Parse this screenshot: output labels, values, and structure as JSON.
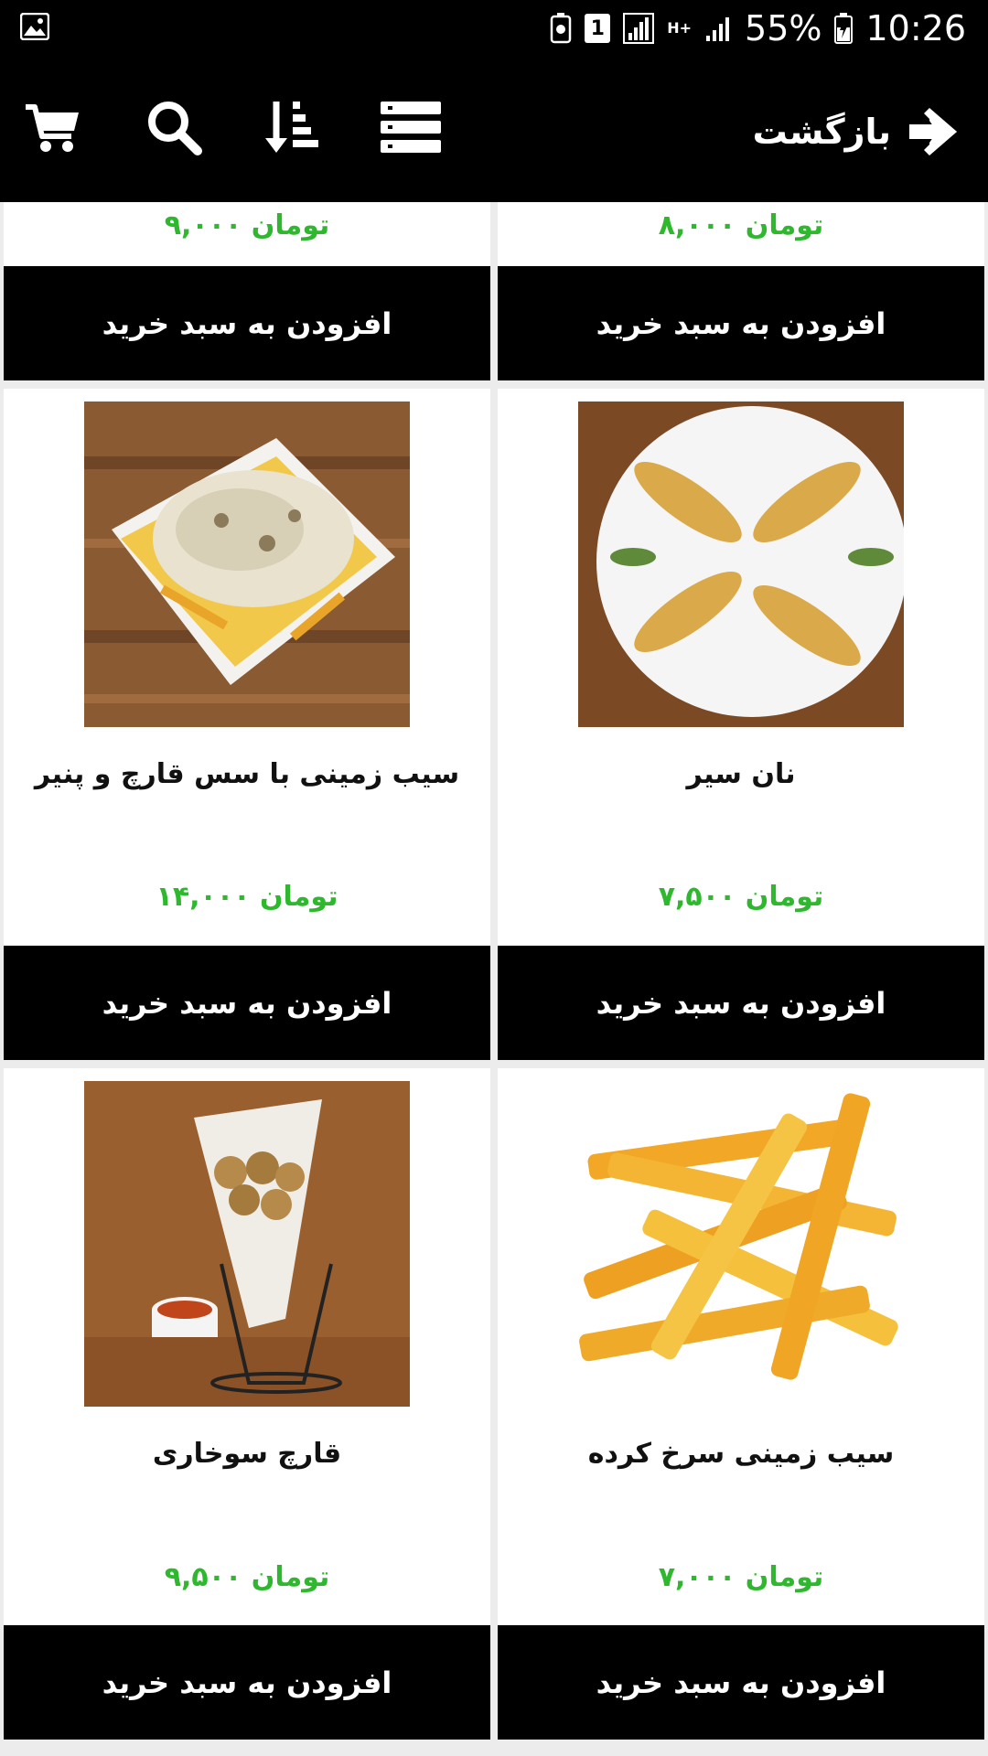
{
  "status_bar": {
    "battery": "55%",
    "time": "10:26",
    "sim_badge": "1",
    "network": "H+"
  },
  "app_bar": {
    "back_label": "بازگشت",
    "icons": [
      "cart-icon",
      "search-icon",
      "sort-icon",
      "list-view-icon",
      "arrow-right-icon"
    ]
  },
  "add_to_cart_label": "افزودن به سبد خرید",
  "products_top": [
    {
      "price": "۹,۰۰۰ تومان"
    },
    {
      "price": "۸,۰۰۰ تومان"
    }
  ],
  "products": [
    {
      "name": "سیب زمینی با سس قارچ و پنیر",
      "price": "۱۴,۰۰۰ تومان",
      "image": "fries-with-mushroom-cheese-sauce"
    },
    {
      "name": "نان سیر",
      "price": "۷,۵۰۰ تومان",
      "image": "garlic-bread"
    },
    {
      "name": "قارچ سوخاری",
      "price": "۹,۵۰۰ تومان",
      "image": "fried-mushrooms-cone"
    },
    {
      "name": "سیب زمینی سرخ کرده",
      "price": "۷,۰۰۰ تومان",
      "image": "crinkle-cut-fries"
    }
  ],
  "colors": {
    "bar": "#000000",
    "price": "#2eb82e",
    "button": "#000000",
    "background": "#ececec"
  }
}
